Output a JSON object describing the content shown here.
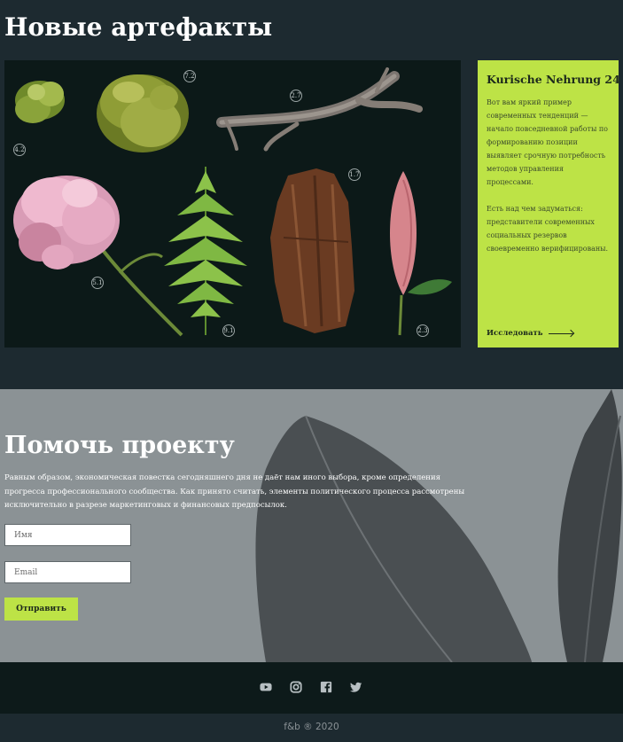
{
  "artifacts": {
    "title": "Новые артефакты",
    "labels": [
      "7.2",
      "2.7",
      "4.2",
      "1.7",
      "5.1",
      "9.1",
      "2.3"
    ]
  },
  "card": {
    "title": "Kurische Nehrung 24",
    "paragraph1": "Вот вам яркий пример современных тенденций — начало повседневной работы по формированию позиции выявляет срочную потребность методов управления процессами.",
    "paragraph2": "Есть над чем задуматься: представители современных социальных резервов своевременно верифицированы.",
    "link_label": "Исследовать"
  },
  "help": {
    "title": "Помочь проекту",
    "text": "Равным образом, экономическая повестка сегодняшнего дня не даёт нам иного выбора, кроме определения прогресса профессионального сообщества. Как принято считать, элементы политического процесса рассмотрены исключительно в разрезе маркетинговых и финансовых предпосылок.",
    "name_placeholder": "Имя",
    "email_placeholder": "Email",
    "submit_label": "Отправить"
  },
  "social": {
    "icons": [
      "youtube-icon",
      "instagram-icon",
      "facebook-icon",
      "twitter-icon"
    ],
    "color": "#b7bfc2"
  },
  "footer": {
    "copyright": "f&b ® 2020"
  },
  "colors": {
    "accent": "#bde346",
    "dark": "#1d2a30",
    "darker": "#0d1a1a"
  }
}
